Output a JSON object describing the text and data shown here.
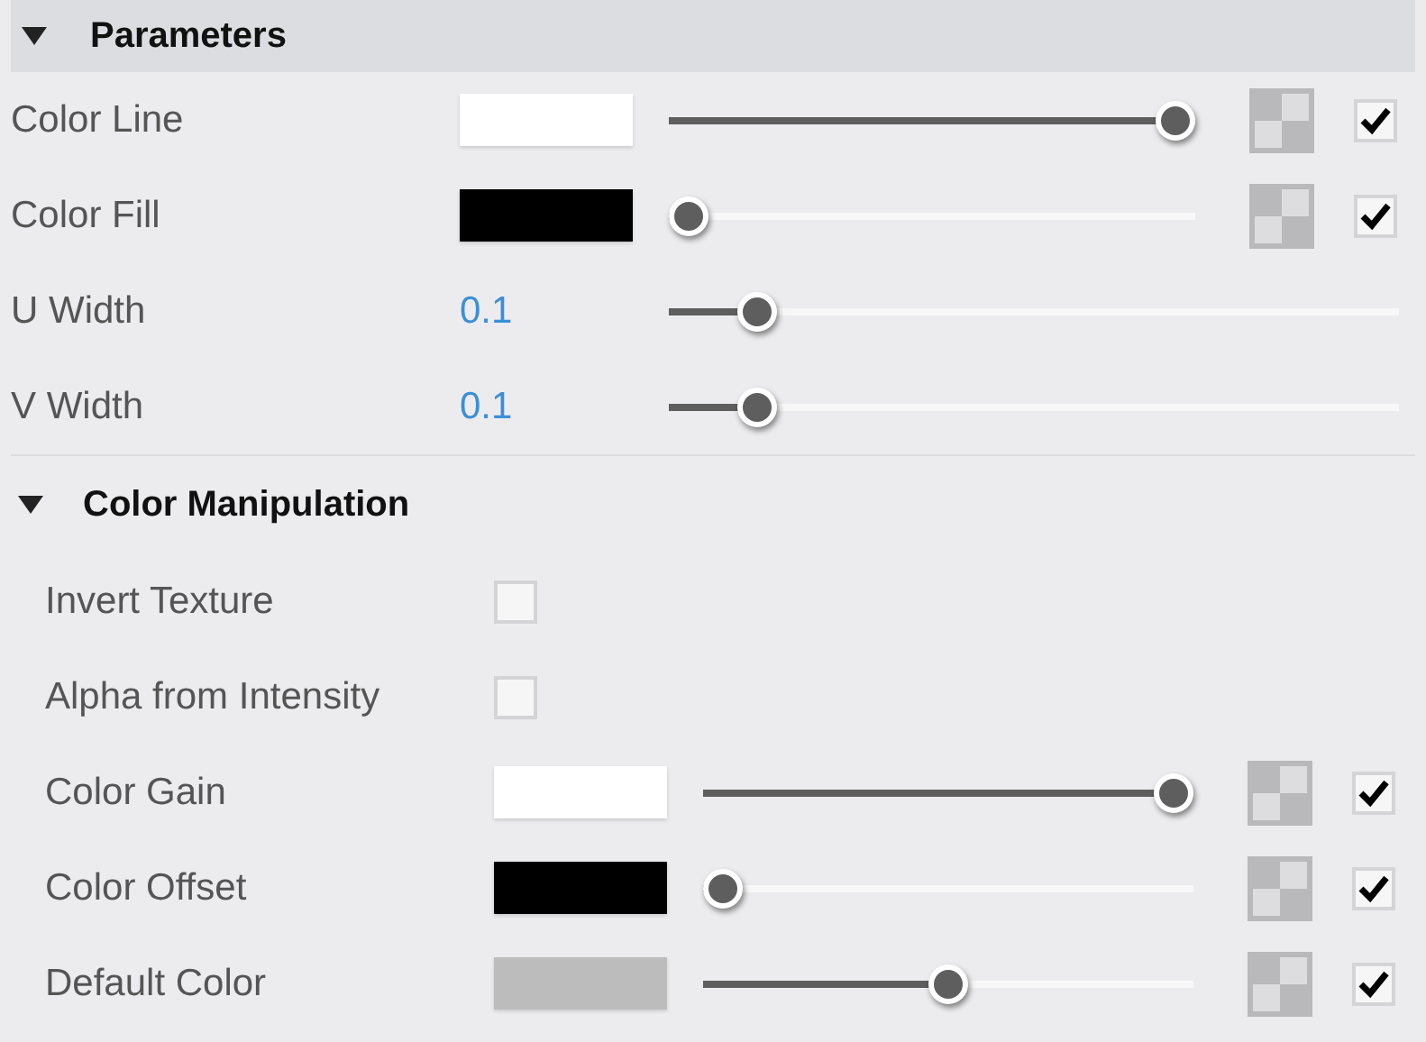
{
  "sections": [
    {
      "title": "Parameters",
      "expanded": true,
      "rows": [
        {
          "kind": "color",
          "label": "Color Line",
          "color": "#ffffff",
          "level": 1,
          "checked": true
        },
        {
          "kind": "color",
          "label": "Color Fill",
          "color": "#000000",
          "level": 0,
          "checked": true
        },
        {
          "kind": "number",
          "label": "U Width",
          "value": "0.1",
          "level": 0.1
        },
        {
          "kind": "number",
          "label": "V Width",
          "value": "0.1",
          "level": 0.1
        }
      ]
    },
    {
      "title": "Color Manipulation",
      "expanded": true,
      "rows": [
        {
          "kind": "toggle",
          "label": "Invert Texture",
          "checked": false
        },
        {
          "kind": "toggle",
          "label": "Alpha from Intensity",
          "checked": false
        },
        {
          "kind": "color",
          "label": "Color Gain",
          "color": "#ffffff",
          "level": 1,
          "checked": true
        },
        {
          "kind": "color",
          "label": "Color Offset",
          "color": "#000000",
          "level": 0,
          "checked": true
        },
        {
          "kind": "color",
          "label": "Default Color",
          "color": "#bcbcbc",
          "level": 0.5,
          "checked": true
        }
      ]
    }
  ]
}
